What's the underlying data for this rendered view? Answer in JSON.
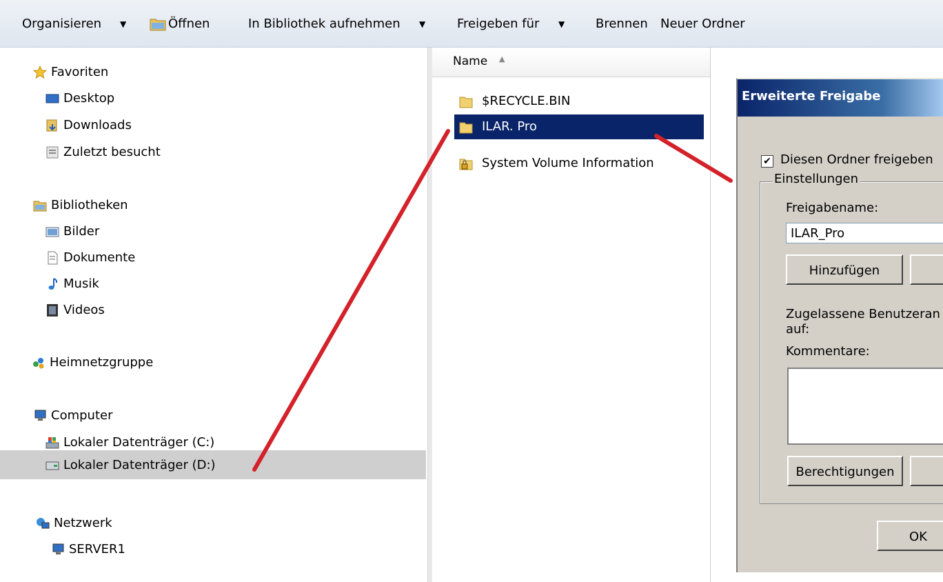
{
  "toolbar": {
    "organize": "Organisieren",
    "open": "Öffnen",
    "add_library": "In Bibliothek aufnehmen",
    "share_with": "Freigeben für",
    "burn": "Brennen",
    "new_folder": "Neuer Ordner"
  },
  "nav": {
    "favorites": "Favoriten",
    "desktop": "Desktop",
    "downloads": "Downloads",
    "recent": "Zuletzt besucht",
    "libraries": "Bibliotheken",
    "pictures": "Bilder",
    "documents": "Dokumente",
    "music": "Musik",
    "videos": "Videos",
    "homegroup": "Heimnetzgruppe",
    "computer": "Computer",
    "drive_c": "Lokaler Datenträger (C:)",
    "drive_d": "Lokaler Datenträger (D:)",
    "network": "Netzwerk",
    "server": "SERVER1"
  },
  "filelist": {
    "column_name": "Name",
    "files": [
      "$RECYCLE.BIN",
      "ILAR. Pro",
      "System Volume Information"
    ]
  },
  "dialog": {
    "title": "Erweiterte Freigabe",
    "share_checkbox": "Diesen Ordner freigeben",
    "settings_group": "Einstellungen",
    "share_name_label": "Freigabename:",
    "share_name_value": "ILAR_Pro",
    "add_button": "Hinzufügen",
    "user_limit_label": "Zugelassene Benutzeran",
    "user_limit_label2": "auf:",
    "comments_label": "Kommentare:",
    "permissions_button": "Berechtigungen",
    "ok_button": "OK"
  },
  "colors": {
    "selection": "#0a246a",
    "annotation": "#d4222a",
    "dialog_bg": "#d4d0c8"
  }
}
